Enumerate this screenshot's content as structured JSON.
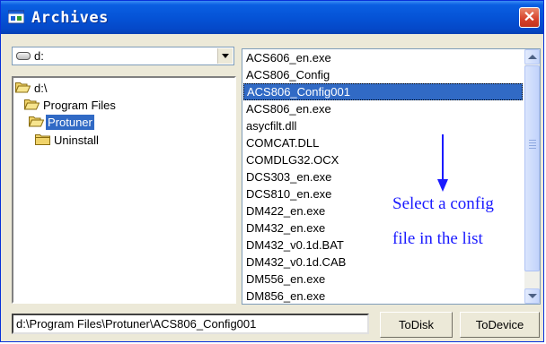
{
  "window": {
    "title": "Archives",
    "close_label": "✕"
  },
  "drive": {
    "selected": "d:"
  },
  "folders": [
    {
      "label": "d:\\",
      "icon": "open-folder-icon",
      "selected": false
    },
    {
      "label": "Program Files",
      "icon": "open-folder-icon",
      "selected": false
    },
    {
      "label": "Protuner",
      "icon": "open-folder-icon",
      "selected": true
    },
    {
      "label": "Uninstall",
      "icon": "folder-icon",
      "selected": false
    }
  ],
  "files": [
    "ACS606_en.exe",
    "ACS806_Config",
    "ACS806_Config001",
    "ACS806_en.exe",
    "asycfilt.dll",
    "COMCAT.DLL",
    "COMDLG32.OCX",
    "DCS303_en.exe",
    "DCS810_en.exe",
    "DM422_en.exe",
    "DM432_en.exe",
    "DM432_v0.1d.BAT",
    "DM432_v0.1d.CAB",
    "DM556_en.exe",
    "DM856_en.exe"
  ],
  "selected_file": "ACS806_Config001",
  "annotation": {
    "line1": "Select a config",
    "line2": "file in the list",
    "color": "#1a1aff"
  },
  "path": "d:\\Program Files\\Protuner\\ACS806_Config001",
  "buttons": {
    "to_disk": "ToDisk",
    "to_device": "ToDevice"
  },
  "colors": {
    "titlebar": "#0553d6",
    "selection": "#316ac5",
    "close": "#d6412a"
  }
}
